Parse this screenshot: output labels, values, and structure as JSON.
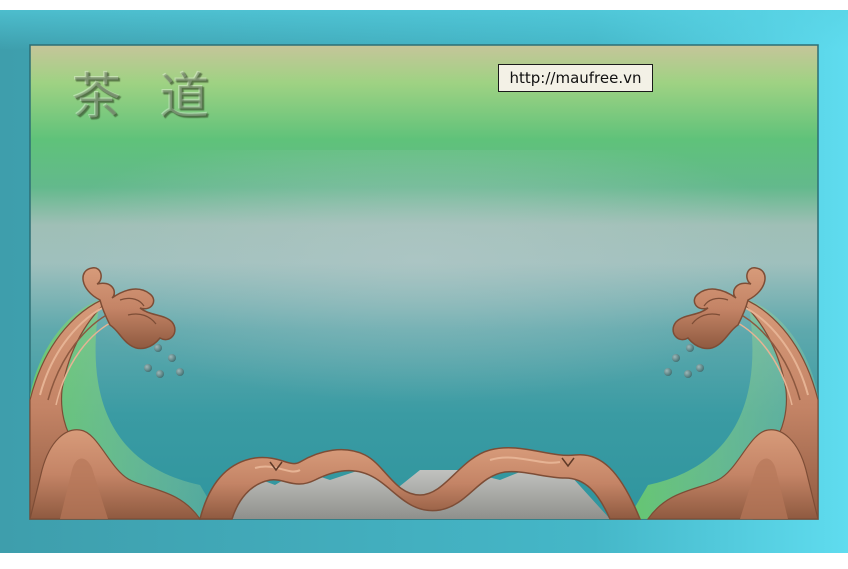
{
  "artwork": {
    "calligraphy": [
      "茶",
      "道"
    ],
    "watermark_url": "http://maufree.vn",
    "colors": {
      "outer_frame": "#3aa4b2",
      "frame_highlight": "#62dcf0",
      "panel_green": "#5fbf72",
      "panel_teal": "#2f9aa3",
      "panel_mist": "#a8c4ba",
      "wave_copper": "#c98a6a",
      "wave_shadow": "#7d4d36",
      "rock_grey": "#a8a9a6"
    }
  }
}
